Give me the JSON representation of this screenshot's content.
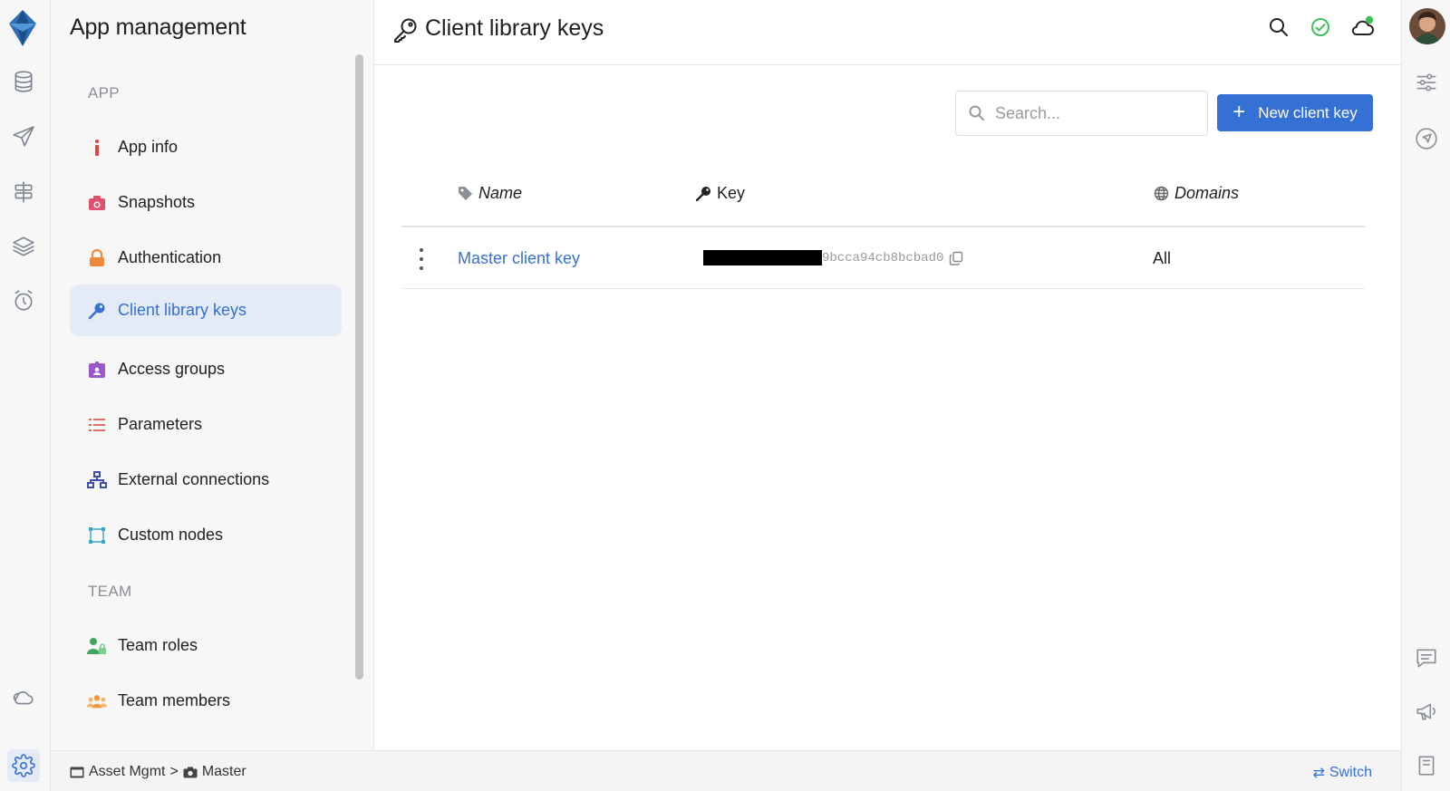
{
  "rail": {
    "items": [
      {
        "name": "database-icon"
      },
      {
        "name": "paper-plane-icon"
      },
      {
        "name": "signpost-icon"
      },
      {
        "name": "layers-icon"
      },
      {
        "name": "alarm-clock-icon"
      },
      {
        "name": "cloud-icon"
      },
      {
        "name": "gear-icon"
      }
    ],
    "active": "gear-icon"
  },
  "sidebar": {
    "title": "App management",
    "sections": [
      {
        "label": "APP",
        "items": [
          {
            "label": "App info",
            "icon": "info-icon"
          },
          {
            "label": "Snapshots",
            "icon": "camera-icon"
          },
          {
            "label": "Authentication",
            "icon": "lock-icon"
          },
          {
            "label": "Client library keys",
            "icon": "key-icon",
            "active": true
          },
          {
            "label": "Access groups",
            "icon": "id-badge-icon"
          },
          {
            "label": "Parameters",
            "icon": "list-icon"
          },
          {
            "label": "External connections",
            "icon": "network-icon"
          },
          {
            "label": "Custom nodes",
            "icon": "nodes-icon"
          }
        ]
      },
      {
        "label": "TEAM",
        "items": [
          {
            "label": "Team roles",
            "icon": "user-lock-icon"
          },
          {
            "label": "Team members",
            "icon": "users-icon"
          }
        ]
      }
    ]
  },
  "header": {
    "title": "Client library keys",
    "icons": [
      "search-icon",
      "check-circle-icon",
      "cloud-icon"
    ],
    "status_color": "#3fbf5a"
  },
  "toolbar": {
    "search_placeholder": "Search...",
    "new_button_label": "New client key"
  },
  "table": {
    "columns": [
      {
        "label": "Name",
        "icon": "tag-icon"
      },
      {
        "label": "Key",
        "icon": "key-icon"
      },
      {
        "label": "Domains",
        "icon": "globe-icon"
      }
    ],
    "rows": [
      {
        "name": "Master client key",
        "key_visible": "9bcca94cb8bcbad0",
        "key_redacted": true,
        "domains": "All"
      }
    ]
  },
  "footer": {
    "breadcrumb": [
      "Asset Mgmt",
      "Master"
    ],
    "separator": ">",
    "switch_label": "Switch"
  },
  "colors": {
    "accent": "#3570d4",
    "active_bg": "#e4ebf7",
    "sidebar_bg": "#f7f7f8"
  }
}
